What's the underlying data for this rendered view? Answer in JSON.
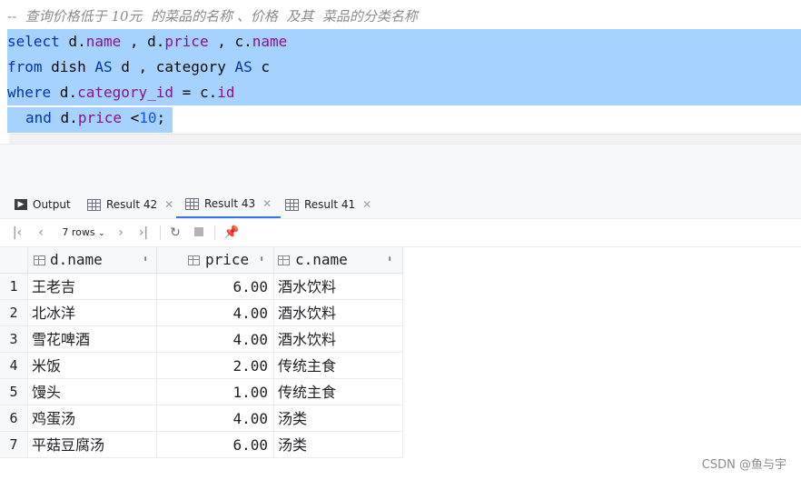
{
  "editor": {
    "comment": "--  查询价格低于 10元  的菜品的名称 、价格  及其  菜品的分类名称",
    "line1": {
      "kw": "select",
      "a": " d.",
      "f1": "name",
      "b": " , d.",
      "f2": "price",
      "c": " , c.",
      "f3": "name"
    },
    "line2": {
      "kw": "from",
      "a": " dish ",
      "kw2": "AS",
      "b": " d , category ",
      "kw3": "AS",
      "c": " c"
    },
    "line3": {
      "kw": "where",
      "a": " d.",
      "f1": "category_id",
      "b": " = c.",
      "f2": "id"
    },
    "line4": {
      "kw": "and",
      "a": " d.",
      "f1": "price",
      "b": " <",
      "n": "10",
      "c": ";"
    }
  },
  "tabs": [
    {
      "label": "Output",
      "icon": "output-icon"
    },
    {
      "label": "Result 42",
      "icon": "grid-icon"
    },
    {
      "label": "Result 43",
      "icon": "grid-icon",
      "active": true
    },
    {
      "label": "Result 41",
      "icon": "grid-icon"
    }
  ],
  "toolbar": {
    "rows_label": "7 rows"
  },
  "table": {
    "columns": [
      "d.name",
      "price",
      "c.name"
    ],
    "rows": [
      {
        "n": "1",
        "name": "王老吉",
        "price": "6.00",
        "cat": "酒水饮料"
      },
      {
        "n": "2",
        "name": "北冰洋",
        "price": "4.00",
        "cat": "酒水饮料"
      },
      {
        "n": "3",
        "name": "雪花啤酒",
        "price": "4.00",
        "cat": "酒水饮料"
      },
      {
        "n": "4",
        "name": "米饭",
        "price": "2.00",
        "cat": "传统主食"
      },
      {
        "n": "5",
        "name": "馒头",
        "price": "1.00",
        "cat": "传统主食"
      },
      {
        "n": "6",
        "name": "鸡蛋汤",
        "price": "4.00",
        "cat": "汤类"
      },
      {
        "n": "7",
        "name": "平菇豆腐汤",
        "price": "6.00",
        "cat": "汤类"
      }
    ]
  },
  "watermark": "CSDN @鱼与宇",
  "colors": {
    "selection": "#a6d2ff",
    "keyword": "#0033b3",
    "field": "#871094",
    "active_tab": "#3574f0"
  }
}
